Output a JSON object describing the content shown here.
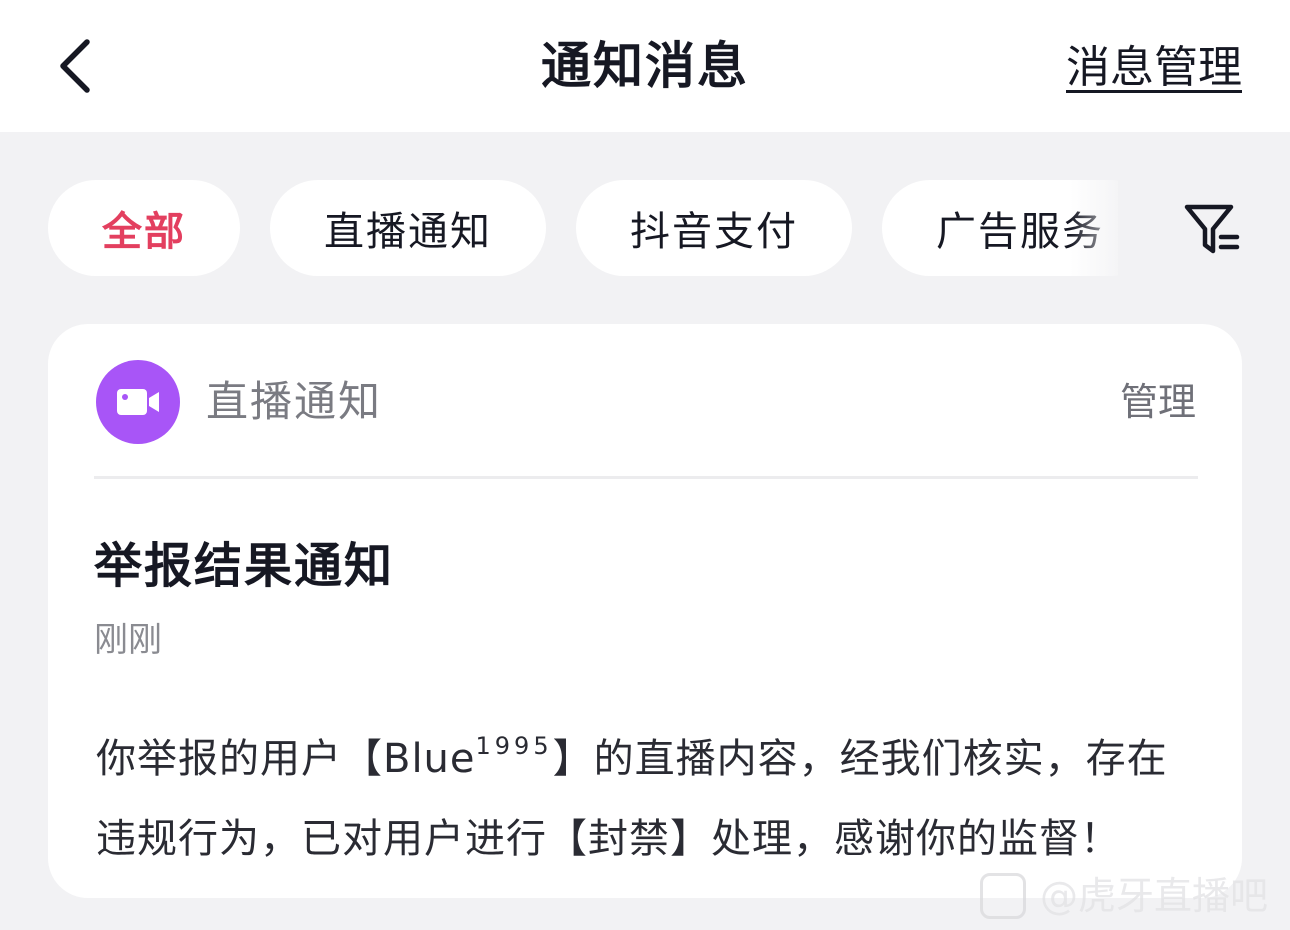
{
  "header": {
    "title": "通知消息",
    "manage_label": "消息管理"
  },
  "tabs": [
    {
      "label": "全部",
      "active": true
    },
    {
      "label": "直播通知",
      "active": false
    },
    {
      "label": "抖音支付",
      "active": false
    },
    {
      "label": "广告服务",
      "active": false
    }
  ],
  "icons": {
    "back": "chevron-left-icon",
    "filter": "filter-icon",
    "source": "video-camera-icon"
  },
  "colors": {
    "accent": "#e33f5f",
    "source_avatar": "#a855f7",
    "background": "#f2f2f4"
  },
  "notification": {
    "source": "直播通知",
    "manage_label": "管理",
    "title": "举报结果通知",
    "time": "刚刚",
    "body_part1": "你举报的用户【Blue",
    "body_sup": "1995",
    "body_part2": "】的直播内容，经我们核实，存在违规行为，已对用户进行【封禁】处理，感谢你的监督！"
  },
  "watermark": {
    "text": "@虎牙直播吧"
  }
}
